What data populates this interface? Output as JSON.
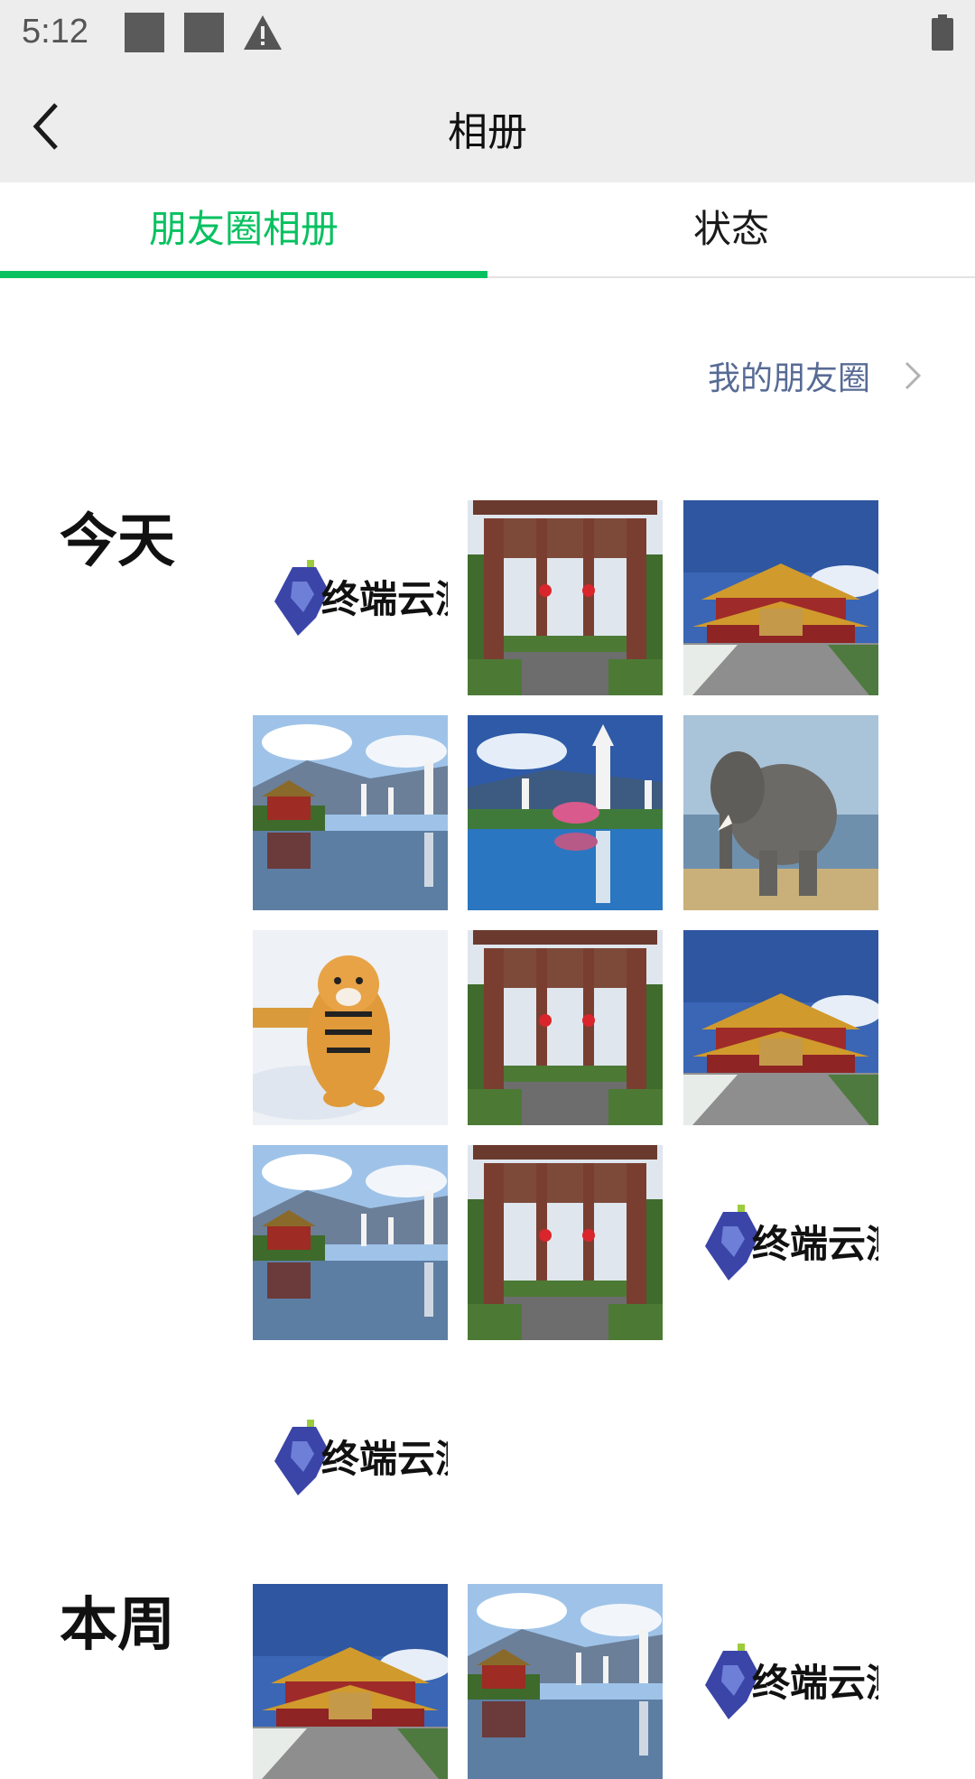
{
  "status_bar": {
    "time": "5:12",
    "icons": [
      "notification-square-icon",
      "notification-square-icon",
      "warning-icon",
      "battery-icon"
    ]
  },
  "title_bar": {
    "title": "相册",
    "back_icon": "back-chevron-icon"
  },
  "tabs": [
    {
      "label": "朋友圈相册",
      "selected": true
    },
    {
      "label": "状态",
      "selected": false
    }
  ],
  "my_moments": {
    "label": "我的朋友圈",
    "icon": "chevron-right-icon"
  },
  "sections": [
    {
      "label": "今天",
      "photos": [
        "logo",
        "gate",
        "temple",
        "pagoda-lake",
        "pagoda-lake-2",
        "elephant",
        "tiger",
        "gate",
        "temple",
        "pagoda-lake",
        "gate",
        "logo",
        "logo"
      ]
    },
    {
      "label": "本周",
      "photos": [
        "temple",
        "pagoda-lake",
        "logo"
      ]
    }
  ],
  "logo_text": "终端云测",
  "colors": {
    "accent": "#07c160",
    "link": "#576b95",
    "bar_bg": "#ededed"
  }
}
